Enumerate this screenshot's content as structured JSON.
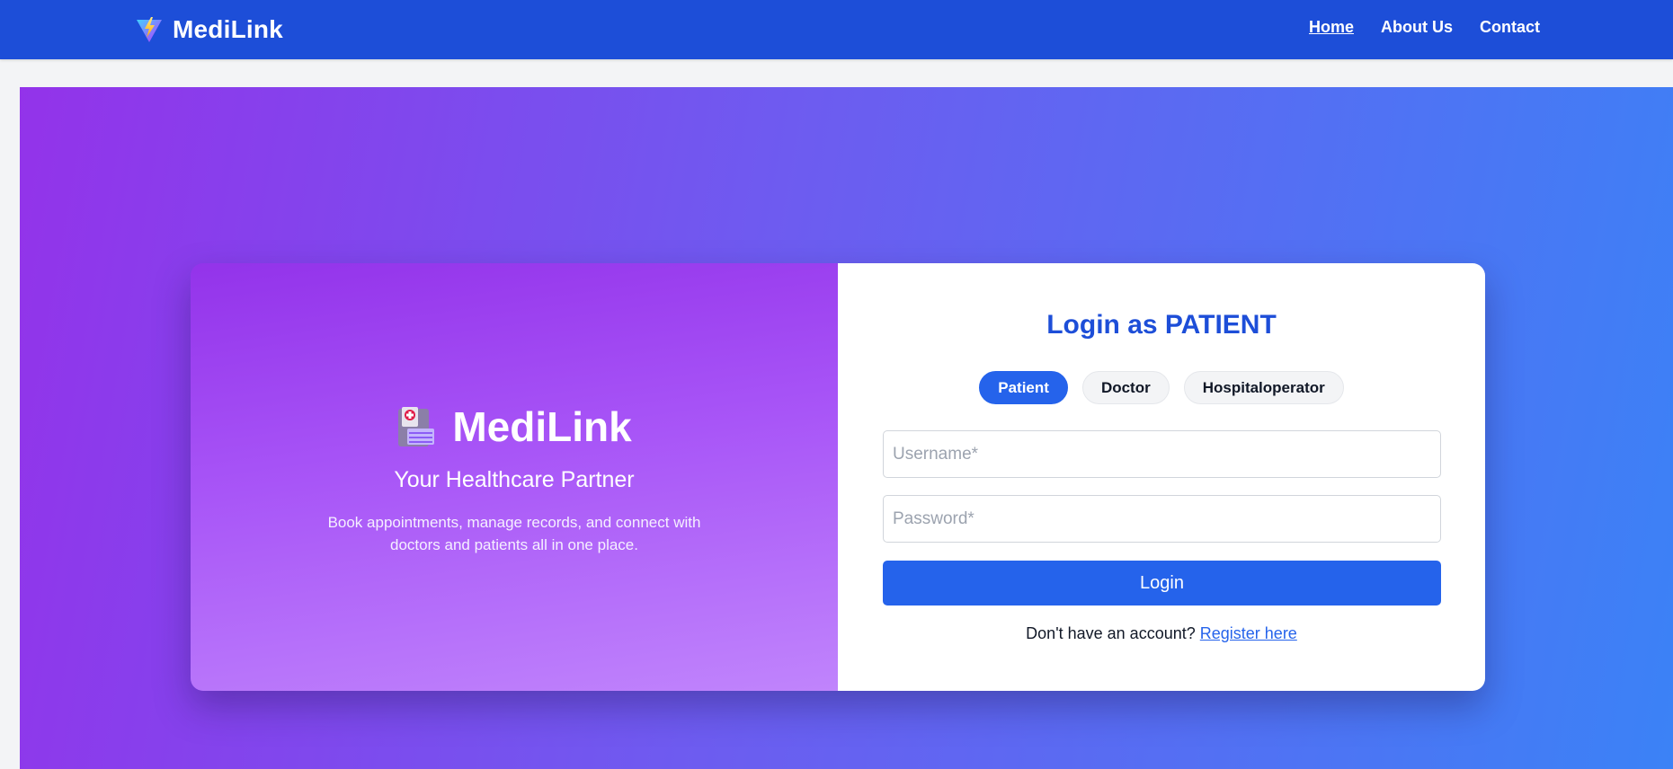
{
  "navbar": {
    "brand": "MediLink",
    "links": [
      {
        "label": "Home",
        "active": true
      },
      {
        "label": "About Us",
        "active": false
      },
      {
        "label": "Contact",
        "active": false
      }
    ],
    "background": "#1d4ed8"
  },
  "hero": {
    "brand": "MediLink",
    "brand_icon": "hospital-icon",
    "tagline": "Your Healthcare Partner",
    "description": "Book appointments, manage records, and connect with doctors and patients all in one place."
  },
  "login": {
    "title": "Login as PATIENT",
    "roles": [
      {
        "label": "Patient",
        "active": true
      },
      {
        "label": "Doctor",
        "active": false
      },
      {
        "label": "Hospitaloperator",
        "active": false
      }
    ],
    "username": {
      "placeholder": "Username*",
      "value": ""
    },
    "password": {
      "placeholder": "Password*",
      "value": ""
    },
    "submit_label": "Login",
    "register_prompt": "Don't have an account?",
    "register_link": "Register here"
  },
  "colors": {
    "accent": "#2563eb",
    "gradient_start": "#9333ea",
    "gradient_end": "#3b82f6"
  }
}
